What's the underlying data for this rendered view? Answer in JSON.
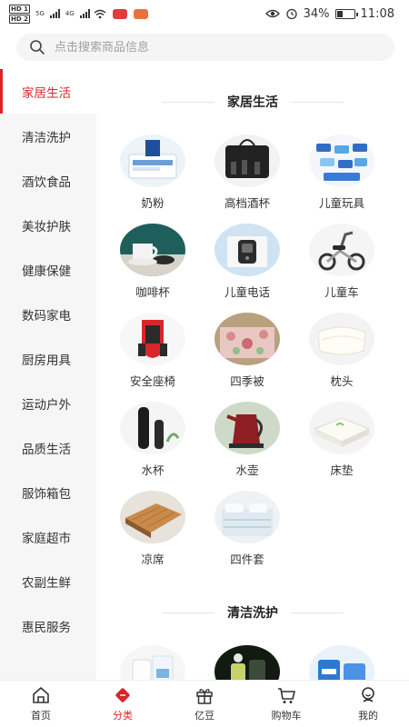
{
  "status_bar": {
    "sim1": "HD 1",
    "sim2": "HD 2",
    "net1": "5G",
    "net2": "4G",
    "battery_percent": "34%",
    "battery_level": 0.34,
    "time": "11:08"
  },
  "search": {
    "placeholder": "点击搜索商品信息",
    "icon": "search-icon"
  },
  "sidebar": {
    "items": [
      {
        "label": "家居生活",
        "active": true
      },
      {
        "label": "清洁洗护"
      },
      {
        "label": "酒饮食品"
      },
      {
        "label": "美妆护肤"
      },
      {
        "label": "健康保健"
      },
      {
        "label": "数码家电"
      },
      {
        "label": "厨房用具"
      },
      {
        "label": "运动户外"
      },
      {
        "label": "品质生活"
      },
      {
        "label": "服饰箱包"
      },
      {
        "label": "家庭超市"
      },
      {
        "label": "农副生鲜"
      },
      {
        "label": "惠民服务"
      }
    ]
  },
  "sections": [
    {
      "title": "家居生活",
      "items": [
        {
          "label": "奶粉",
          "thumb": "milk-powder"
        },
        {
          "label": "高档酒杯",
          "thumb": "wine-glass"
        },
        {
          "label": "儿童玩具",
          "thumb": "toy-cars"
        },
        {
          "label": "咖啡杯",
          "thumb": "coffee-cup"
        },
        {
          "label": "儿童电话",
          "thumb": "kids-phone"
        },
        {
          "label": "儿童车",
          "thumb": "kids-bike"
        },
        {
          "label": "安全座椅",
          "thumb": "car-seat"
        },
        {
          "label": "四季被",
          "thumb": "quilt"
        },
        {
          "label": "枕头",
          "thumb": "pillow"
        },
        {
          "label": "水杯",
          "thumb": "thermos"
        },
        {
          "label": "水壶",
          "thumb": "kettle"
        },
        {
          "label": "床垫",
          "thumb": "mattress"
        },
        {
          "label": "凉席",
          "thumb": "summer-mat"
        },
        {
          "label": "四件套",
          "thumb": "bedding-set"
        }
      ]
    },
    {
      "title": "清洁洗护",
      "items": [
        {
          "label": "",
          "thumb": "tissue-roll"
        },
        {
          "label": "",
          "thumb": "detergent"
        },
        {
          "label": "",
          "thumb": "wipes"
        }
      ]
    }
  ],
  "tabbar": {
    "items": [
      {
        "label": "首页",
        "icon": "home-icon"
      },
      {
        "label": "分类",
        "icon": "category-icon",
        "active": true
      },
      {
        "label": "亿豆",
        "icon": "gift-icon"
      },
      {
        "label": "购物车",
        "icon": "cart-icon"
      },
      {
        "label": "我的",
        "icon": "profile-icon"
      }
    ]
  },
  "colors": {
    "accent": "#d9262b",
    "sidebar_bg": "#f6f6f6"
  }
}
